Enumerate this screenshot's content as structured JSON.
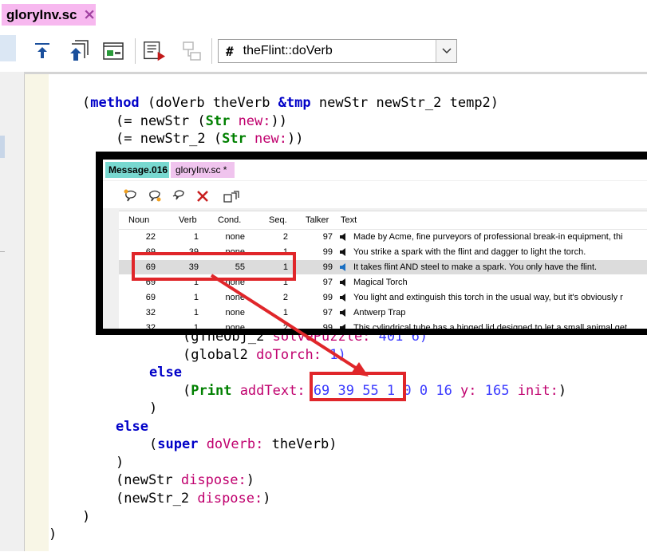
{
  "window": {
    "tab_label": "gloryInv.sc",
    "tab_close": "×",
    "combo_hash": "#",
    "combo_value": "theFlint::doVerb"
  },
  "code_lines": [
    [
      "(",
      "method",
      " (doVerb theVerb ",
      "&tmp",
      " newStr newStr_2 temp2)"
    ],
    [
      "(= newStr (",
      "Str",
      " ",
      "new:",
      "))"
    ],
    [
      "(= newStr_2 (",
      "Str",
      " ",
      "new:",
      "))"
    ]
  ],
  "code_tail": {
    "gfile_line_a": "(gTheObj_2 ",
    "gfile_line_b": "solvePuzzle:",
    "gfile_line_c": " 401 6)",
    "global_a": "(global2 ",
    "global_b": "doTorch:",
    "global_c": " 1)",
    "else1": "else",
    "print_open": "(",
    "print_kw": "Print",
    "print_sp": " ",
    "print_sel": "addText:",
    "print_nums": " 69 39 55 1 0 0 16 ",
    "print_y": "y:",
    "print_num2": " 165 ",
    "print_init": "init:",
    "print_close": ")",
    "close_paren1": ")",
    "else2": "else",
    "super_open": "(",
    "super_kw": "super",
    "super_sp": " ",
    "super_sel": "doVerb:",
    "super_rest": " theVerb)",
    "close_paren2": ")",
    "dispose1_a": "(newStr ",
    "dispose1_b": "dispose:",
    "dispose1_c": ")",
    "dispose2_a": "(newStr_2 ",
    "dispose2_b": "dispose:",
    "dispose2_c": ")",
    "close_paren3": ")",
    "close_paren4": ")"
  },
  "message_editor": {
    "tab1": "Message.016",
    "tab2": "gloryInv.sc *",
    "columns": [
      "Noun",
      "Verb",
      "Cond.",
      "Seq.",
      "Talker",
      "Text"
    ],
    "rows": [
      {
        "noun": "22",
        "verb": "1",
        "cond": "none",
        "seq": "2",
        "talker": "97",
        "text": "Made by Acme, fine purveyors of professional break-in equipment, thi",
        "selected": false
      },
      {
        "noun": "69",
        "verb": "39",
        "cond": "none",
        "seq": "1",
        "talker": "99",
        "text": "You strike a spark with the flint and dagger to light the torch.",
        "selected": false
      },
      {
        "noun": "69",
        "verb": "39",
        "cond": "55",
        "seq": "1",
        "talker": "99",
        "text": "It takes flint AND steel to make a spark.  You only have the flint.",
        "selected": true
      },
      {
        "noun": "69",
        "verb": "1",
        "cond": "none",
        "seq": "1",
        "talker": "97",
        "text": "Magical Torch",
        "selected": false
      },
      {
        "noun": "69",
        "verb": "1",
        "cond": "none",
        "seq": "2",
        "talker": "99",
        "text": "You light and extinguish this torch in the usual way, but it's obviously r",
        "selected": false
      },
      {
        "noun": "32",
        "verb": "1",
        "cond": "none",
        "seq": "1",
        "talker": "97",
        "text": "Antwerp Trap",
        "selected": false
      },
      {
        "noun": "32",
        "verb": "1",
        "cond": "none",
        "seq": "2",
        "talker": "99",
        "text": "This cylindrical tube has a hinged lid designed to let a small animal get",
        "selected": false
      }
    ]
  },
  "colors": {
    "annotation_red": "#e0262a",
    "tab_pink": "#f7b8ef",
    "tab_teal": "#78d8d0"
  }
}
